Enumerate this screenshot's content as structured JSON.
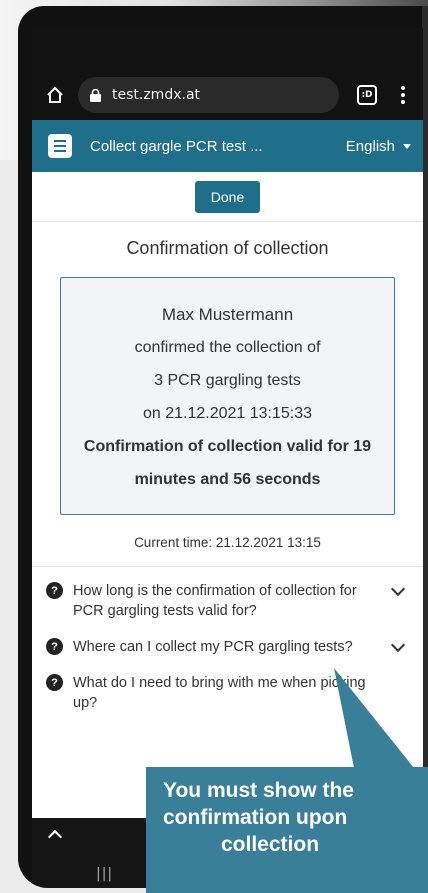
{
  "browser": {
    "url": "test.zmdx.at",
    "tabs_label": ":D"
  },
  "appbar": {
    "title": "Collect gargle PCR test ...",
    "language": "English"
  },
  "page": {
    "done_label": "Done",
    "title": "Confirmation of collection",
    "card": {
      "name": "Max Mustermann",
      "line2": "confirmed the collection of",
      "line3": "3 PCR gargling tests",
      "line4": "on 21.12.2021 13:15:33",
      "validity_line1": "Confirmation of collection valid for 19",
      "validity_line2": "minutes and 56 seconds"
    },
    "current_time": "Current time: 21.12.2021 13:15"
  },
  "faq": [
    {
      "question": "How long is the confirmation of collection for PCR gargling tests valid for?"
    },
    {
      "question": "Where can I collect my PCR gargling tests?"
    },
    {
      "question": "What do I need to bring with me when picking up?"
    }
  ],
  "navbar": {
    "recent_symbol": "|||"
  },
  "callout": {
    "line1": "You must show the",
    "line2": "confirmation upon",
    "line3": "collection"
  },
  "colors": {
    "brand": "#1f6f8b",
    "callout": "#3a7f9a",
    "card_border": "#3c7f98"
  }
}
